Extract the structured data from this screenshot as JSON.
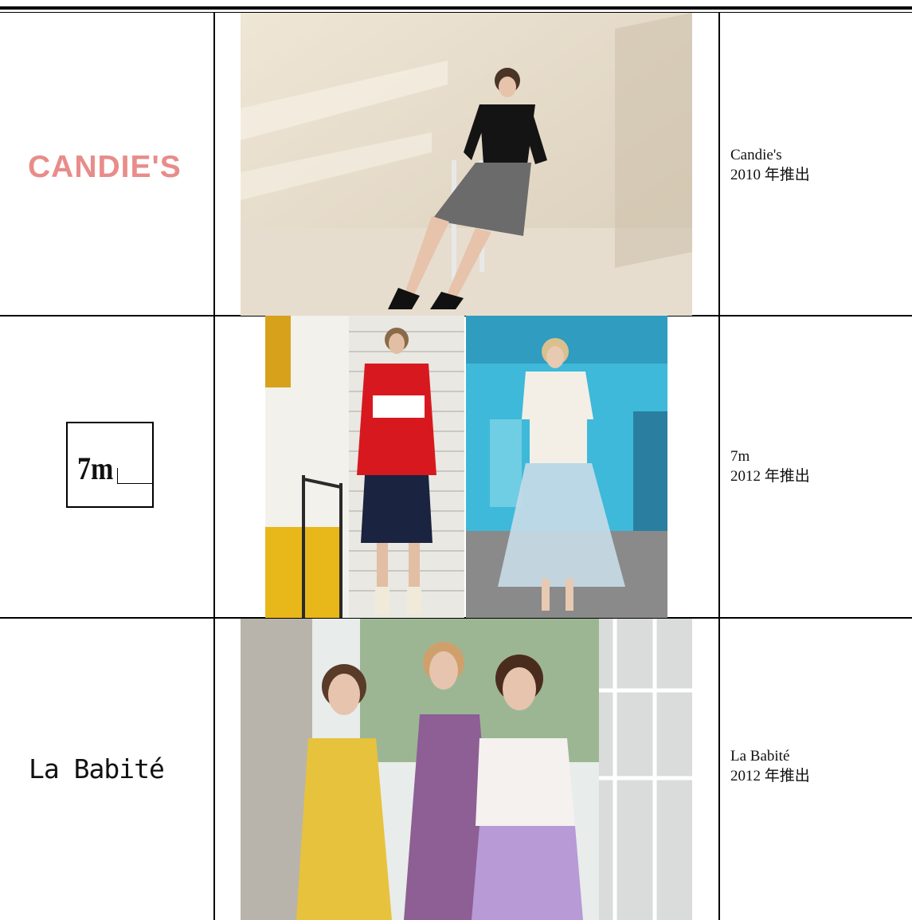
{
  "rows": [
    {
      "logo": {
        "text": "CANDIE'S",
        "color": "#e88c8a"
      },
      "photo": {
        "subject": "model seated on chair in black top and grey skirt"
      },
      "info": {
        "name": "Candie's",
        "year": "2010 年推出"
      }
    },
    {
      "logo": {
        "text": "7m",
        "color": "#000000"
      },
      "photo": {
        "subject": "two models: red sweatshirt with denim skirt; white tee with tulle skirt"
      },
      "info": {
        "name": "7m",
        "year": "2012 年推出"
      }
    },
    {
      "logo": {
        "text": "La Babité",
        "color": "#111111"
      },
      "photo": {
        "subject": "three models in greenhouse wearing summer dresses"
      },
      "info": {
        "name": "La Babité",
        "year": "2012 年推出"
      }
    }
  ],
  "colors": {
    "rule": "#000000",
    "background": "#ffffff",
    "accent_pink": "#e88c8a"
  }
}
